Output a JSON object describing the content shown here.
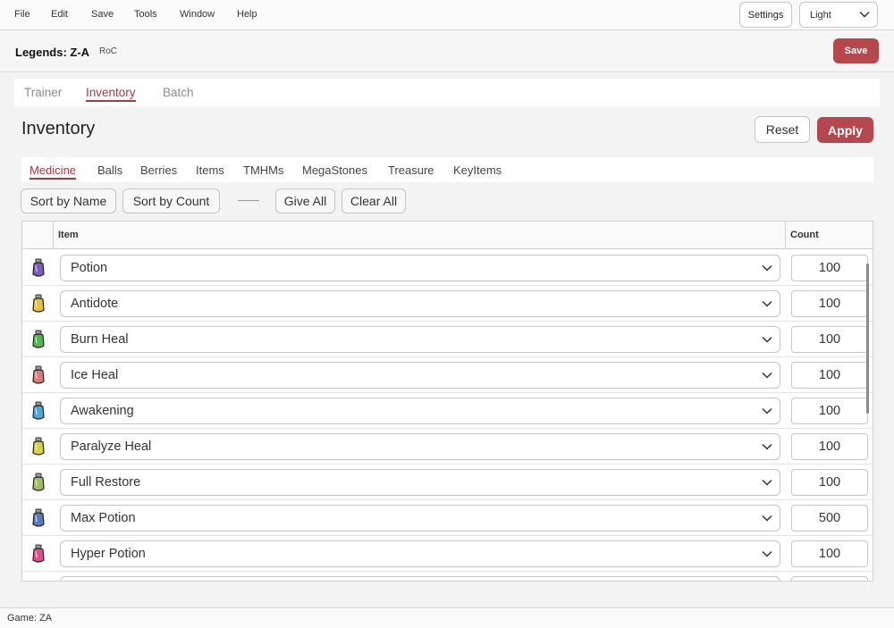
{
  "menu": {
    "items": [
      "File",
      "Edit",
      "Save",
      "Tools",
      "Window",
      "Help"
    ],
    "settings_label": "Settings",
    "theme_value": "Light"
  },
  "header": {
    "title": "Legends: Z-A",
    "tag": "RoC",
    "save_label": "Save"
  },
  "main_tabs": [
    {
      "label": "Trainer",
      "active": false
    },
    {
      "label": "Inventory",
      "active": true
    },
    {
      "label": "Batch",
      "active": false
    }
  ],
  "page": {
    "title": "Inventory",
    "reset_label": "Reset",
    "apply_label": "Apply"
  },
  "sub_tabs": [
    {
      "label": "Medicine",
      "active": true
    },
    {
      "label": "Balls",
      "active": false
    },
    {
      "label": "Berries",
      "active": false
    },
    {
      "label": "Items",
      "active": false
    },
    {
      "label": "TMHMs",
      "active": false
    },
    {
      "label": "MegaStones",
      "active": false
    },
    {
      "label": "Treasure",
      "active": false
    },
    {
      "label": "KeyItems",
      "active": false
    }
  ],
  "toolbar": {
    "sort_name": "Sort by Name",
    "sort_count": "Sort by Count",
    "give_all": "Give All",
    "clear_all": "Clear All"
  },
  "grid": {
    "col_item": "Item",
    "col_count": "Count",
    "rows": [
      {
        "name": "Potion",
        "count": "100",
        "icon": "potion-icon",
        "color": "#7a5cc4"
      },
      {
        "name": "Antidote",
        "count": "100",
        "icon": "antidote-icon",
        "color": "#e6c23a"
      },
      {
        "name": "Burn Heal",
        "count": "100",
        "icon": "burn-heal-icon",
        "color": "#4fb84f"
      },
      {
        "name": "Ice Heal",
        "count": "100",
        "icon": "ice-heal-icon",
        "color": "#e07a7a"
      },
      {
        "name": "Awakening",
        "count": "100",
        "icon": "awakening-icon",
        "color": "#4aa8d8"
      },
      {
        "name": "Paralyze Heal",
        "count": "100",
        "icon": "paralyze-heal-icon",
        "color": "#d8d040"
      },
      {
        "name": "Full Restore",
        "count": "100",
        "icon": "full-restore-icon",
        "color": "#9ac060"
      },
      {
        "name": "Max Potion",
        "count": "500",
        "icon": "max-potion-icon",
        "color": "#5a78c0"
      },
      {
        "name": "Hyper Potion",
        "count": "100",
        "icon": "hyper-potion-icon",
        "color": "#e0508a"
      }
    ]
  },
  "status": {
    "text": "Game: ZA"
  }
}
